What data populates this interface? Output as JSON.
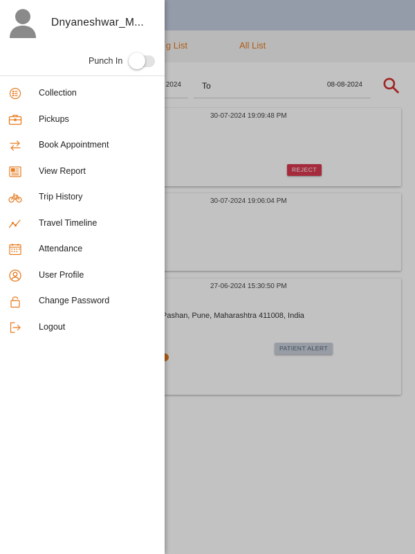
{
  "user": {
    "name": "Dnyaneshwar_M..."
  },
  "punch": {
    "label": "Punch In",
    "on": false
  },
  "menu": [
    {
      "label": "Collection",
      "icon": "list-icon"
    },
    {
      "label": "Pickups",
      "icon": "briefcase-icon"
    },
    {
      "label": "Book Appointment",
      "icon": "swap-arrows-icon"
    },
    {
      "label": "View Report",
      "icon": "newspaper-icon"
    },
    {
      "label": "Trip History",
      "icon": "bicycle-icon"
    },
    {
      "label": "Travel Timeline",
      "icon": "trend-line-icon"
    },
    {
      "label": "Attendance",
      "icon": "calendar-icon"
    },
    {
      "label": "User Profile",
      "icon": "user-circle-icon"
    },
    {
      "label": "Change Password",
      "icon": "lock-icon"
    },
    {
      "label": "Logout",
      "icon": "logout-icon"
    }
  ],
  "tabs": {
    "first_partial": "g List",
    "second": "All List"
  },
  "filter": {
    "from_value_partial": "2024",
    "to_label": "To",
    "to_value": "08-08-2024"
  },
  "cards": [
    {
      "datetime": "30-07-2024 19:09:48 PM",
      "status": "REJECT"
    },
    {
      "datetime": "30-07-2024 19:06:04 PM"
    },
    {
      "datetime": "27-06-2024 15:30:50 PM",
      "address_partial": "Pashan, Pune, Maharashtra 411008, India",
      "alert": "PATIENT ALERT"
    }
  ],
  "colors": {
    "accent": "#e67a1e",
    "reject": "#d9394f",
    "search": "#d32f2f",
    "app_bar": "#c3cedf"
  }
}
